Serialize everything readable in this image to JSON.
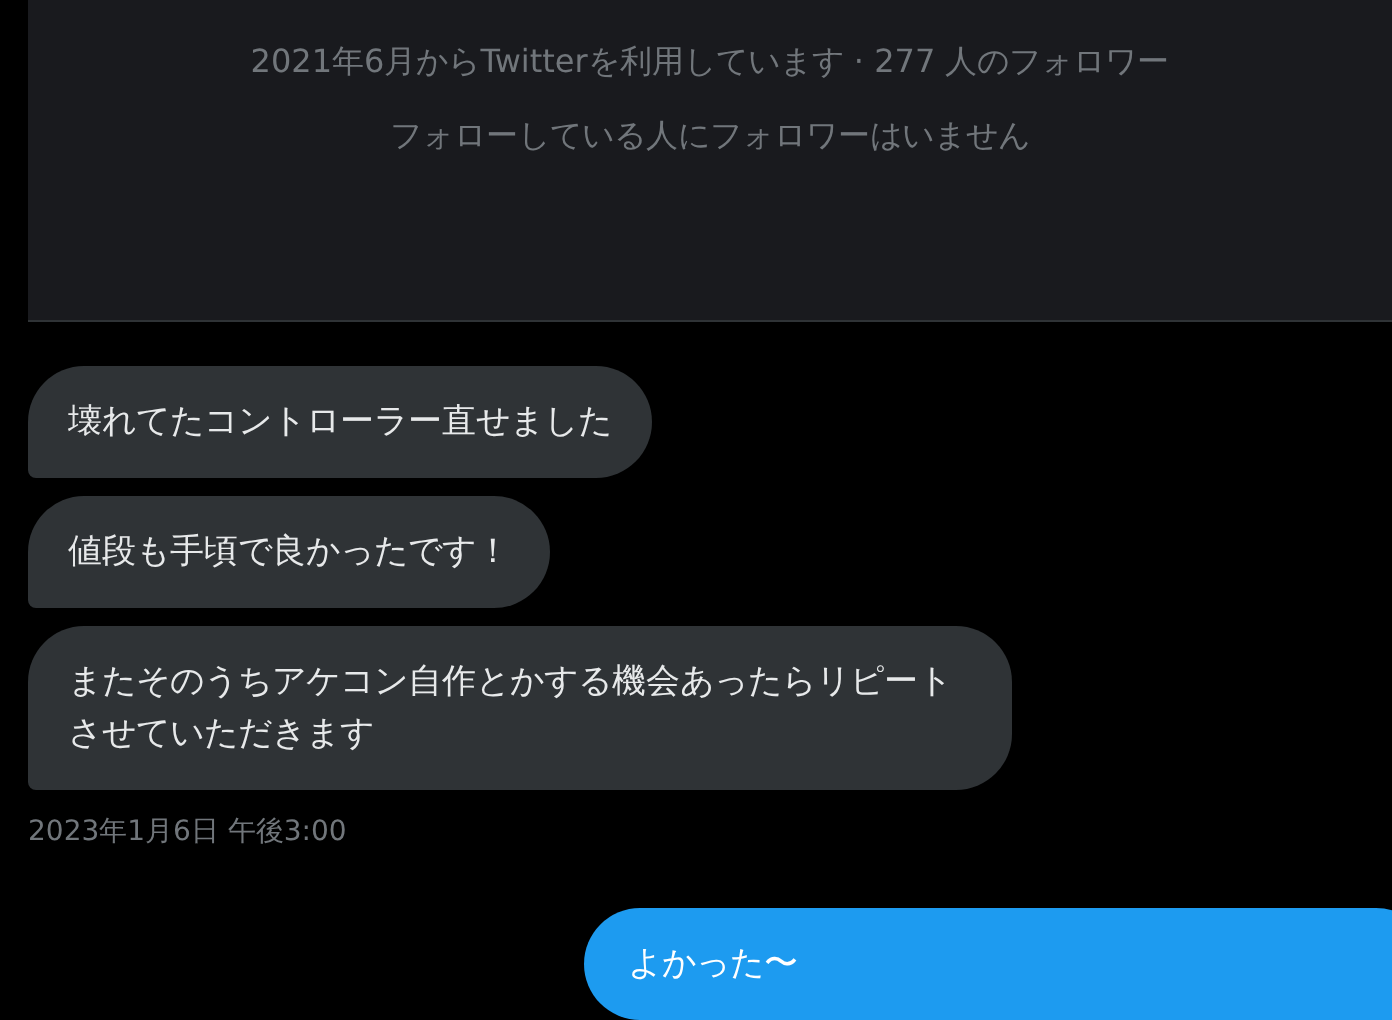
{
  "profile_card": {
    "joined": "2021年6月からTwitterを利用しています · 277 人のフォロワー",
    "mutuals": "フォローしている人にフォロワーはいません"
  },
  "messages": [
    {
      "kind": "received",
      "text": "壊れてたコントローラー直せました"
    },
    {
      "kind": "received",
      "text": "値段も手頃で良かったです！"
    },
    {
      "kind": "received",
      "text": "またそのうちアケコン自作とかする機会あったらリピートさせていただきます"
    },
    {
      "kind": "timestamp",
      "text": "2023年1月6日 午後3:00"
    },
    {
      "kind": "sent",
      "text": "よかった〜"
    }
  ]
}
